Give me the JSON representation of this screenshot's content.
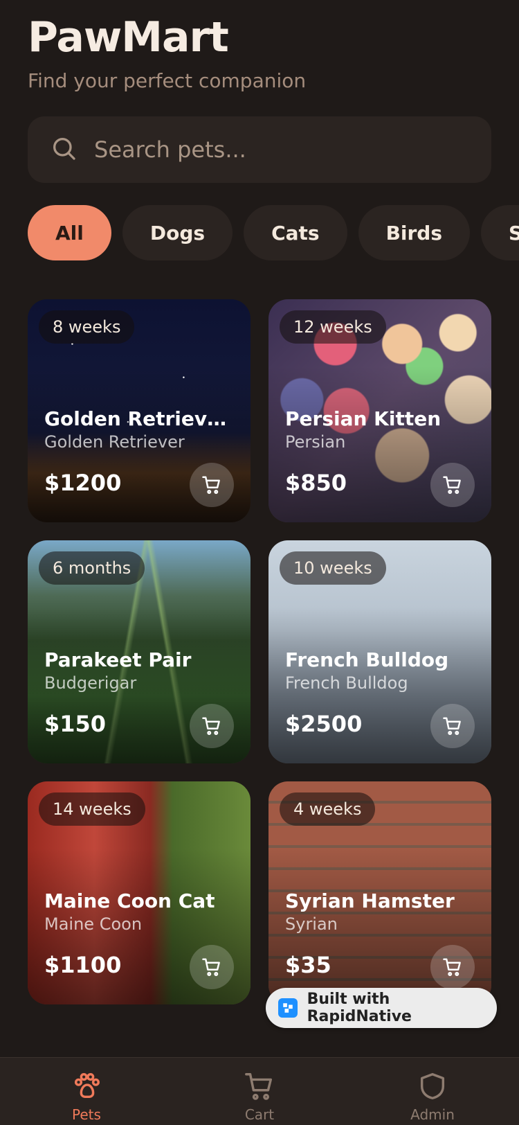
{
  "header": {
    "title": "PawMart",
    "subtitle": "Find your perfect companion"
  },
  "search": {
    "placeholder": "Search pets...",
    "value": ""
  },
  "categories": [
    "All",
    "Dogs",
    "Cats",
    "Birds",
    "Small Pets"
  ],
  "selected_category": "All",
  "pets": [
    {
      "age": "8 weeks",
      "name": "Golden Retriever Puppy",
      "breed": "Golden Retriever",
      "price": "$1200"
    },
    {
      "age": "12 weeks",
      "name": "Persian Kitten",
      "breed": "Persian",
      "price": "$850"
    },
    {
      "age": "6 months",
      "name": "Parakeet Pair",
      "breed": "Budgerigar",
      "price": "$150"
    },
    {
      "age": "10 weeks",
      "name": "French Bulldog",
      "breed": "French Bulldog",
      "price": "$2500"
    },
    {
      "age": "14 weeks",
      "name": "Maine Coon Cat",
      "breed": "Maine Coon",
      "price": "$1100"
    },
    {
      "age": "4 weeks",
      "name": "Syrian Hamster",
      "breed": "Syrian",
      "price": "$35"
    }
  ],
  "badge": {
    "label": "Built with RapidNative"
  },
  "tabs": [
    {
      "label": "Pets",
      "icon": "paw-icon",
      "active": true
    },
    {
      "label": "Cart",
      "icon": "cart-icon",
      "active": false
    },
    {
      "label": "Admin",
      "icon": "shield-icon",
      "active": false
    }
  ],
  "colors": {
    "background": "#1f1a18",
    "accent": "#f18a6a",
    "surface": "#2b2421"
  }
}
